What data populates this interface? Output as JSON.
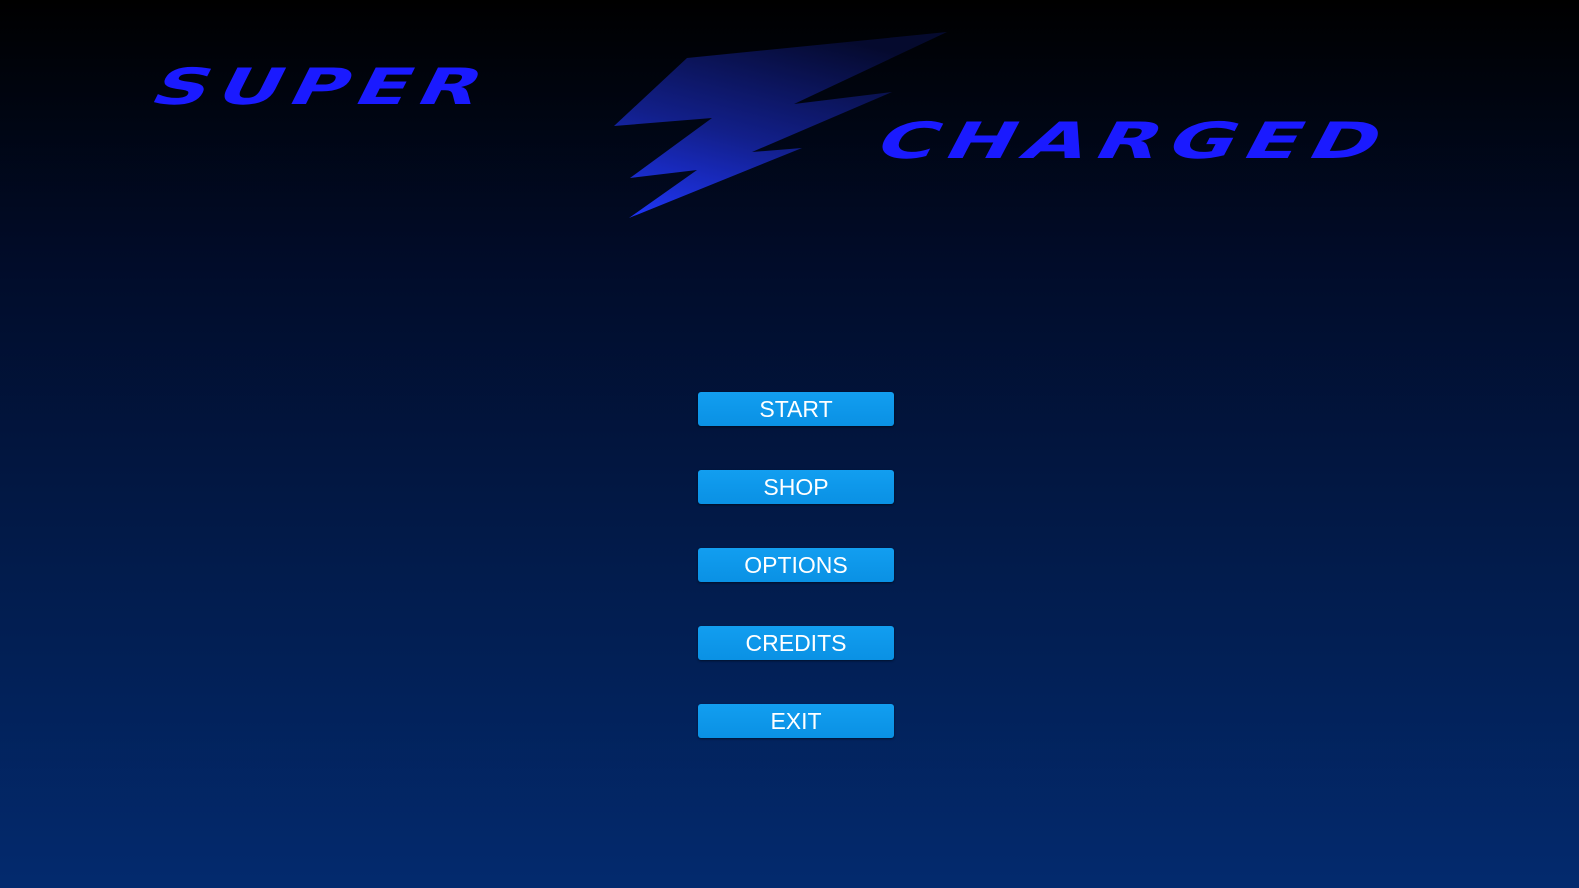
{
  "logo": {
    "word_left": "SUPER",
    "word_right": "CHARGED",
    "icon": "lightning-bolt-icon",
    "color": "#1a1aff"
  },
  "menu": {
    "buttons": [
      {
        "label": "START"
      },
      {
        "label": "SHOP"
      },
      {
        "label": "OPTIONS"
      },
      {
        "label": "CREDITS"
      },
      {
        "label": "EXIT"
      }
    ],
    "button_color": "#0a91e4",
    "text_color": "#ffffff"
  },
  "background": {
    "top_color": "#000000",
    "bottom_color": "#032a6e"
  }
}
